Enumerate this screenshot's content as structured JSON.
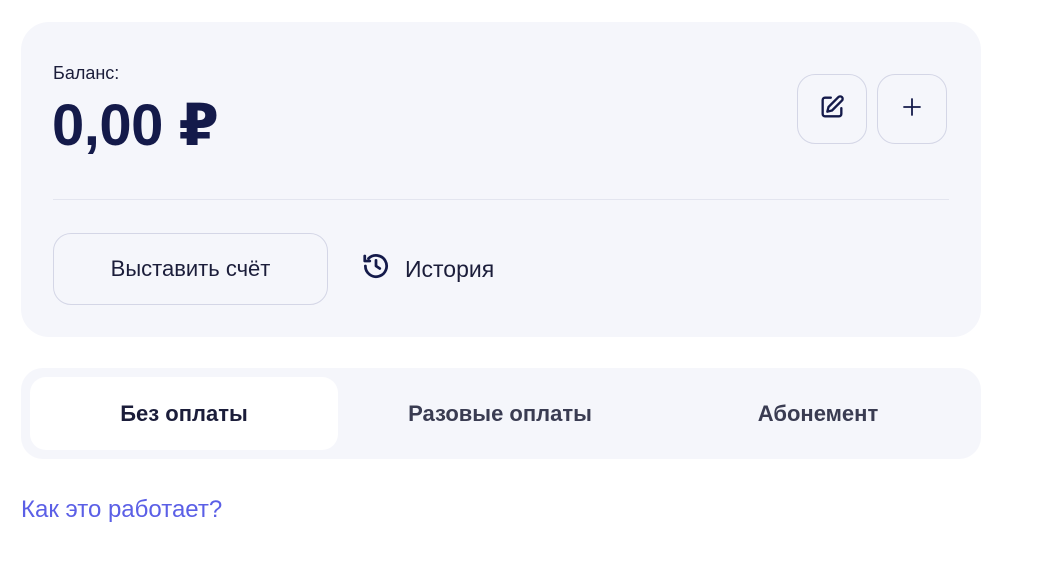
{
  "balance": {
    "label": "Баланс:",
    "amount": "0,00 ₽"
  },
  "actions": {
    "edit_icon": "pencil-square-icon",
    "add_icon": "plus-icon",
    "invoice_label": "Выставить счёт",
    "history_label": "История",
    "history_icon": "history-clock-icon"
  },
  "tabs": [
    {
      "label": "Без оплаты",
      "active": true
    },
    {
      "label": "Разовые оплаты",
      "active": false
    },
    {
      "label": "Абонемент",
      "active": false
    }
  ],
  "help_link": "Как это работает?",
  "colors": {
    "card_bg": "#f5f6fb",
    "text_dark": "#141a4a",
    "link": "#5b5fe6",
    "border": "#d4d6e6"
  }
}
